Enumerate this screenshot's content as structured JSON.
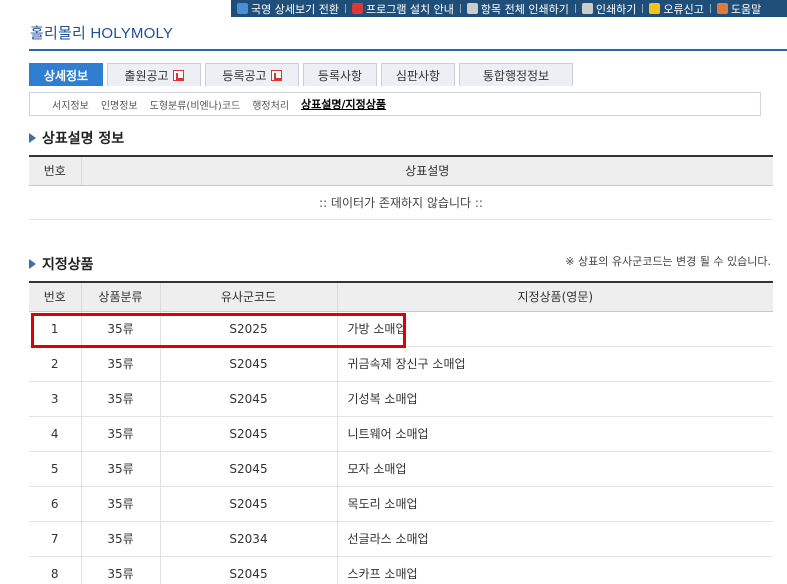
{
  "toolbar": {
    "items": [
      {
        "label": "국영 상세보기 전환",
        "icon": "language-switch-icon",
        "color": "#4a8fd6"
      },
      {
        "label": "프로그램 설치 안내",
        "icon": "install-icon",
        "color": "#d83a3a"
      },
      {
        "label": "항목 전체 인쇄하기",
        "icon": "print-icon",
        "color": "#cccccc"
      },
      {
        "label": "인쇄하기",
        "icon": "print-icon",
        "color": "#cccccc"
      },
      {
        "label": "오류신고",
        "icon": "warning-icon",
        "color": "#f3c21b"
      },
      {
        "label": "도움말",
        "icon": "help-icon",
        "color": "#e07a3a"
      }
    ]
  },
  "app_title": "홀리몰리 HOLYMOLY",
  "tabs": [
    {
      "label": "상세정보",
      "active": true,
      "pdf": false
    },
    {
      "label": "출원공고",
      "active": false,
      "pdf": true
    },
    {
      "label": "등록공고",
      "active": false,
      "pdf": true
    },
    {
      "label": "등록사항",
      "active": false,
      "pdf": false
    },
    {
      "label": "심판사항",
      "active": false,
      "pdf": false
    },
    {
      "label": "통합행정정보",
      "active": false,
      "pdf": false
    }
  ],
  "subtabs": [
    {
      "label": "서지정보",
      "active": false
    },
    {
      "label": "인명정보",
      "active": false
    },
    {
      "label": "도형분류(비엔나)코드",
      "active": false
    },
    {
      "label": "행정처리",
      "active": false
    },
    {
      "label": "상표설명/지정상품",
      "active": true
    }
  ],
  "desc_section": {
    "title": "상표설명 정보",
    "columns": [
      "번호",
      "상표설명"
    ],
    "empty_message": ":: 데이터가 존재하지 않습니다 ::"
  },
  "goods_section": {
    "title": "지정상품",
    "note": "※ 상표의 유사군코드는 변경 될 수 있습니다.",
    "columns": [
      "번호",
      "상품분류",
      "유사군코드",
      "지정상품(영문)"
    ],
    "rows": [
      [
        "1",
        "35류",
        "S2025",
        "가방 소매업"
      ],
      [
        "2",
        "35류",
        "S2045",
        "귀금속제 장신구 소매업"
      ],
      [
        "3",
        "35류",
        "S2045",
        "기성복 소매업"
      ],
      [
        "4",
        "35류",
        "S2045",
        "니트웨어 소매업"
      ],
      [
        "5",
        "35류",
        "S2045",
        "모자 소매업"
      ],
      [
        "6",
        "35류",
        "S2045",
        "목도리 소매업"
      ],
      [
        "7",
        "35류",
        "S2034",
        "선글라스 소매업"
      ],
      [
        "8",
        "35류",
        "S2045",
        "스카프 소매업"
      ]
    ]
  },
  "colors": {
    "accent": "#2e7fd1",
    "title": "#1f4e96",
    "highlight": "#e00000"
  }
}
